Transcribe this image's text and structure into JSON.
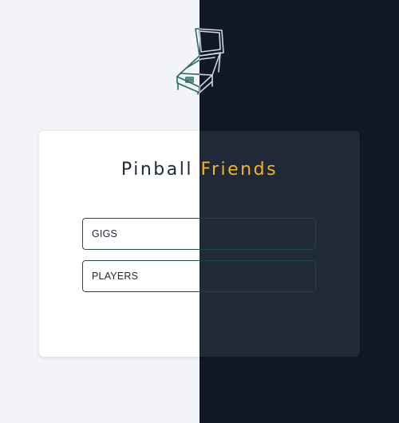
{
  "app": {
    "title_part1": "Pinball",
    "title_part2": "Friends"
  },
  "menu": {
    "items": [
      {
        "label": "GIGS"
      },
      {
        "label": "PLAYERS"
      }
    ]
  },
  "colors": {
    "accent": "#f0b429",
    "background_light": "#f2f4f7",
    "background_dark": "#121826",
    "card_light": "#ffffff",
    "card_dark": "#1f2937",
    "border_teal": "#1f5149"
  },
  "icons": {
    "logo": "pinball-machine-icon"
  }
}
